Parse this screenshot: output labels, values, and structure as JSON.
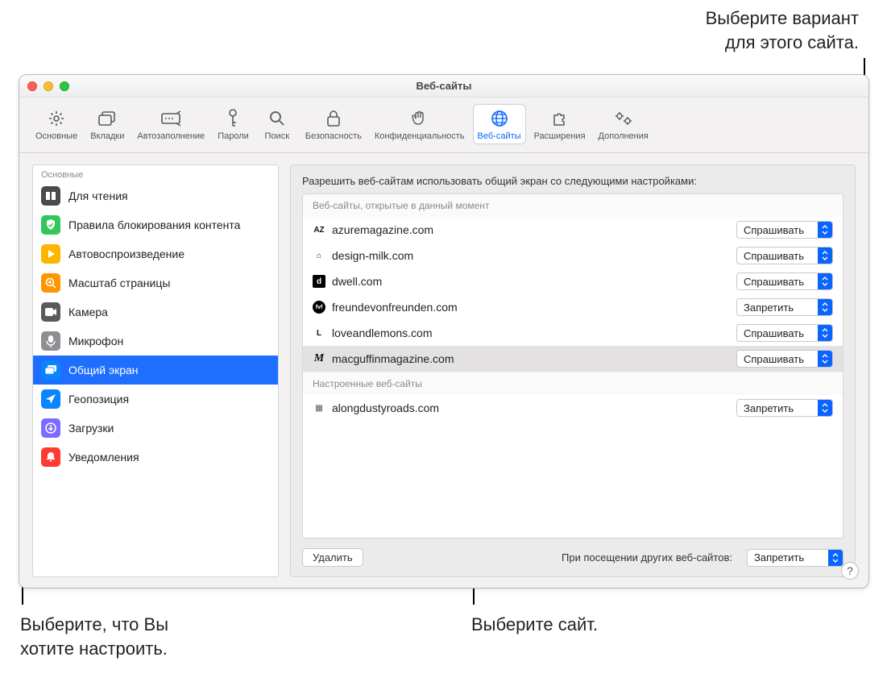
{
  "callouts": {
    "top": {
      "line1": "Выберите вариант",
      "line2": "для этого сайта."
    },
    "left": {
      "line1": "Выберите, что Вы",
      "line2": "хотите настроить."
    },
    "middle": {
      "line1": "Выберите сайт."
    }
  },
  "window": {
    "title": "Веб-сайты",
    "toolbar": [
      {
        "label": "Основные",
        "name": "tab-general",
        "icon": "gear"
      },
      {
        "label": "Вкладки",
        "name": "tab-tabs",
        "icon": "tabs"
      },
      {
        "label": "Автозаполнение",
        "name": "tab-autofill",
        "icon": "autofill"
      },
      {
        "label": "Пароли",
        "name": "tab-passwords",
        "icon": "key"
      },
      {
        "label": "Поиск",
        "name": "tab-search",
        "icon": "search"
      },
      {
        "label": "Безопасность",
        "name": "tab-security",
        "icon": "lock"
      },
      {
        "label": "Конфиденциальность",
        "name": "tab-privacy",
        "icon": "hand"
      },
      {
        "label": "Веб-сайты",
        "name": "tab-websites",
        "icon": "globe",
        "active": true
      },
      {
        "label": "Расширения",
        "name": "tab-extensions",
        "icon": "puzzle"
      },
      {
        "label": "Дополнения",
        "name": "tab-advanced",
        "icon": "gears"
      }
    ],
    "sidebar": {
      "groupLabel": "Основные",
      "items": [
        {
          "label": "Для чтения",
          "icon": "book",
          "color": "#4a4a4a"
        },
        {
          "label": "Правила блокирования контента",
          "icon": "shield",
          "color": "#33c759"
        },
        {
          "label": "Автовоспроизведение",
          "icon": "play",
          "color": "#ffb400"
        },
        {
          "label": "Масштаб страницы",
          "icon": "zoom",
          "color": "#ff9500"
        },
        {
          "label": "Камера",
          "icon": "camera",
          "color": "#5a5a5c"
        },
        {
          "label": "Микрофон",
          "icon": "mic",
          "color": "#8e8e93"
        },
        {
          "label": "Общий экран",
          "icon": "screens",
          "color": "#0a84ff",
          "selected": true
        },
        {
          "label": "Геопозиция",
          "icon": "location",
          "color": "#0a84ff"
        },
        {
          "label": "Загрузки",
          "icon": "download",
          "color": "#7d6bff"
        },
        {
          "label": "Уведомления",
          "icon": "bell",
          "color": "#ff3b30"
        }
      ]
    },
    "main": {
      "heading": "Разрешить веб-сайтам использовать общий экран со следующими настройками:",
      "openHeader": "Веб-сайты, открытые в данный момент",
      "configuredHeader": "Настроенные веб-сайты",
      "openSites": [
        {
          "favicon": "AZ",
          "domain": "azuremagazine.com",
          "value": "Спрашивать"
        },
        {
          "favicon": "⌂",
          "domain": "design-milk.com",
          "value": "Спрашивать"
        },
        {
          "favicon": "d",
          "domain": "dwell.com",
          "value": "Спрашивать",
          "inv": true
        },
        {
          "favicon": "fvf",
          "domain": "freundevonfreunden.com",
          "value": "Запретить",
          "round": true
        },
        {
          "favicon": "L",
          "domain": "loveandlemons.com",
          "value": "Спрашивать"
        },
        {
          "favicon": "M",
          "domain": "macguffinmagazine.com",
          "value": "Спрашивать",
          "highlight": true,
          "italic": true
        }
      ],
      "configuredSites": [
        {
          "favicon": "▦",
          "domain": "alongdustyroads.com",
          "value": "Запретить"
        }
      ],
      "deleteLabel": "Удалить",
      "otherLabel": "При посещении других веб-сайтов:",
      "otherValue": "Запретить"
    }
  }
}
